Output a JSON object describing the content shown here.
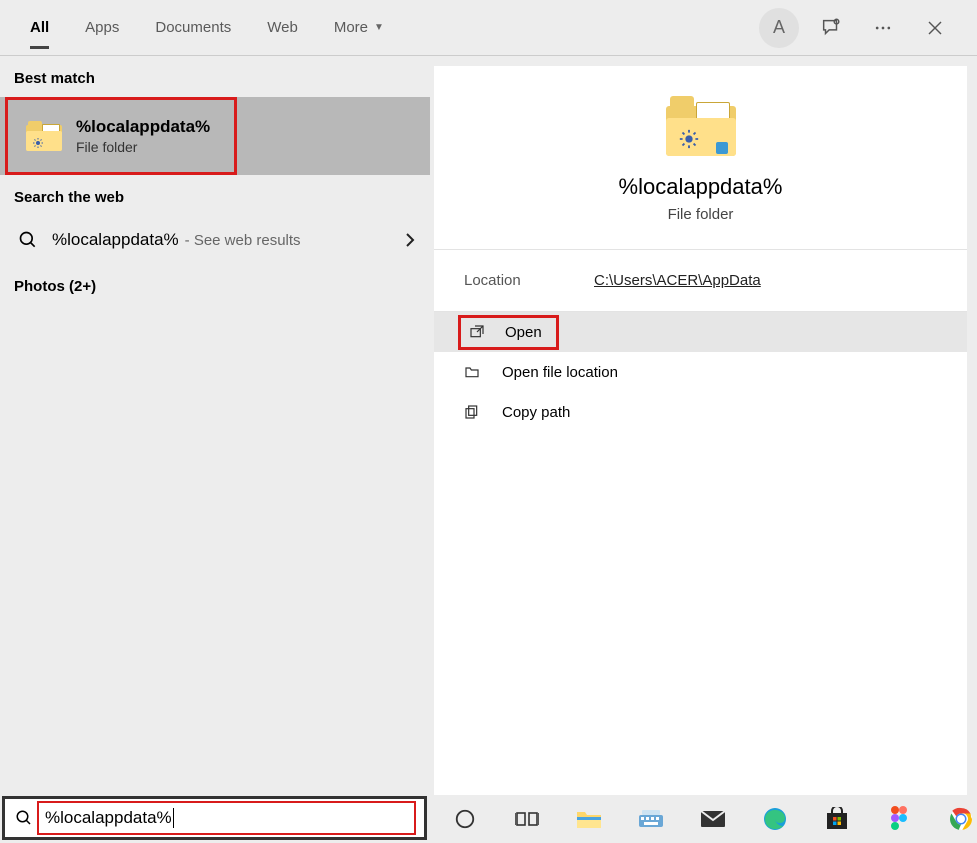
{
  "tabs": {
    "items": [
      "All",
      "Apps",
      "Documents",
      "Web",
      "More"
    ],
    "active_index": 0
  },
  "avatar_initial": "A",
  "left": {
    "best_match_label": "Best match",
    "best_match": {
      "title": "%localappdata%",
      "subtitle": "File folder"
    },
    "search_web_label": "Search the web",
    "web_item": {
      "term": "%localappdata%",
      "subtitle": "- See web results"
    },
    "photos_label": "Photos (2+)"
  },
  "detail": {
    "title": "%localappdata%",
    "subtitle": "File folder",
    "location_label": "Location",
    "location_value": "C:\\Users\\ACER\\AppData",
    "actions": {
      "open": "Open",
      "open_location": "Open file location",
      "copy_path": "Copy path"
    }
  },
  "searchbox": {
    "value": "%localappdata%"
  },
  "icons": {
    "chat": "chat-icon",
    "more": "more-icon",
    "close": "close-icon"
  }
}
